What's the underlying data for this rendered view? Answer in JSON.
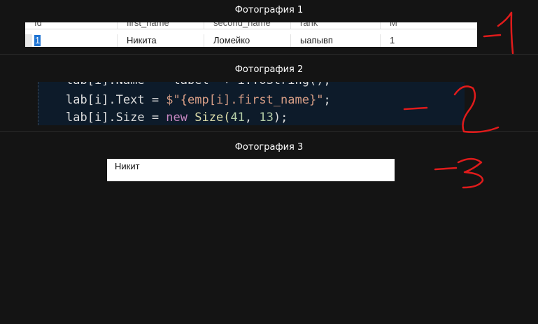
{
  "captions": [
    "Фотография 1",
    "Фотография 2",
    "Фотография 3"
  ],
  "grid": {
    "columns": [
      "Id",
      "first_name",
      "second_name",
      "rank",
      "M"
    ],
    "row": [
      "1",
      "Никита",
      "Ломейко",
      "ыапывп",
      "1"
    ]
  },
  "code": {
    "line1": "lab[i].Name = \"label\" + i.ToString();",
    "line2_prefix": "lab[i].Text = ",
    "line2_string": "$\"{emp[i].first_name}\"",
    "line2_suffix": ";",
    "line3_prefix": "lab[i].Size = ",
    "line3_keyword": "new",
    "line3_type": " Size(",
    "line3_num1": "41",
    "line3_sep": ", ",
    "line3_num2": "13",
    "line3_suffix": ");"
  },
  "label_preview": "Никит",
  "annotations": {
    "color": "#e01b1b",
    "marks": [
      "-1",
      "-2",
      "-3"
    ]
  }
}
